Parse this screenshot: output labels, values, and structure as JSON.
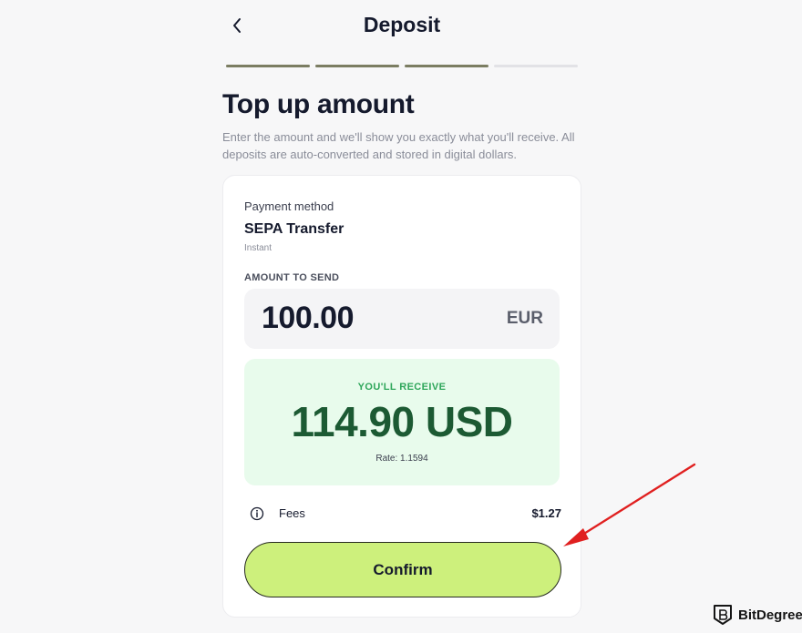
{
  "header": {
    "title": "Deposit"
  },
  "progress": {
    "steps_total": 4,
    "steps_done": 3,
    "done_color": "#7b7d62",
    "todo_color": "#e2e2e6"
  },
  "page": {
    "heading": "Top up amount",
    "description": "Enter the amount and we'll show you exactly what you'll receive. All deposits are auto-converted and stored in digital dollars."
  },
  "payment": {
    "label": "Payment method",
    "method": "SEPA Transfer",
    "speed": "Instant"
  },
  "amount": {
    "label": "AMOUNT TO SEND",
    "value": "100.00",
    "currency": "EUR"
  },
  "receive": {
    "label": "YOU'LL RECEIVE",
    "value": "114.90 USD",
    "rate": "Rate: 1.1594"
  },
  "fees": {
    "label": "Fees",
    "value": "$1.27",
    "icon": "info-icon"
  },
  "confirm": {
    "label": "Confirm",
    "color": "#cdf07c"
  },
  "annotation": {
    "arrow_color": "#e02020"
  },
  "watermark": {
    "brand": "BitDegree"
  }
}
